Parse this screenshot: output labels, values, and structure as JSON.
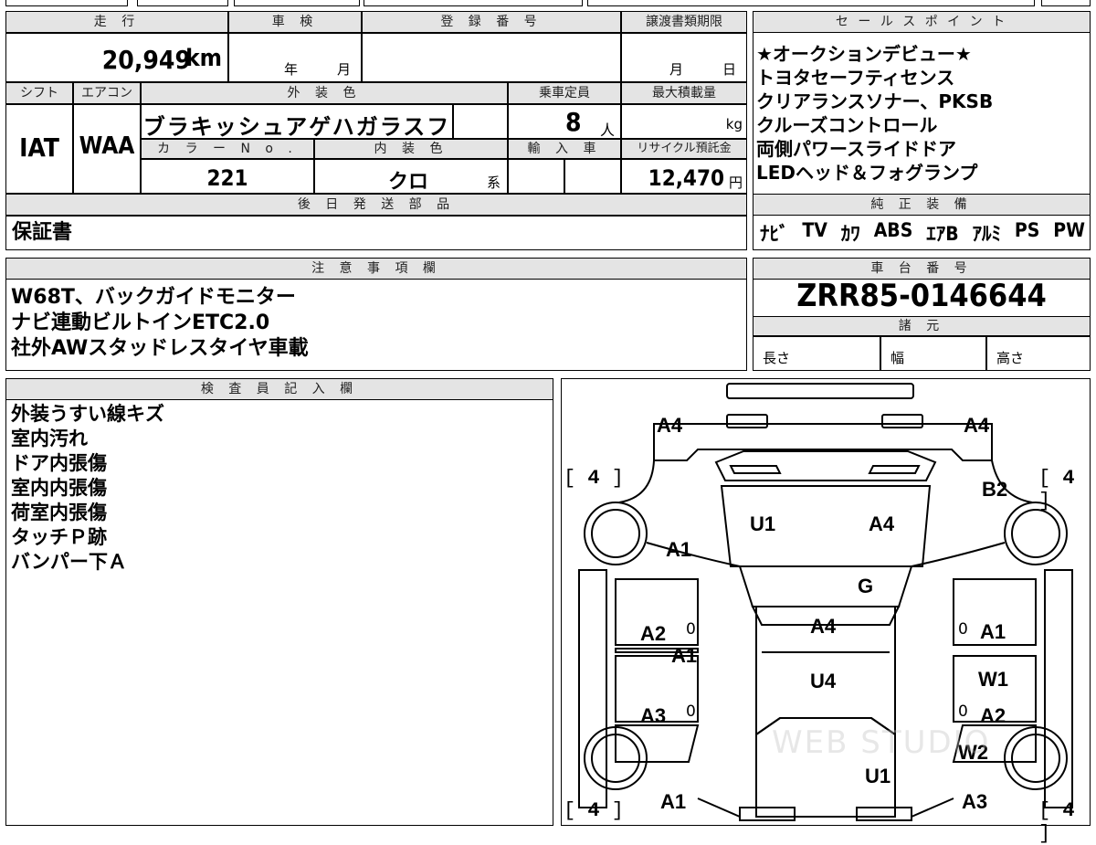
{
  "top_strip": [
    "",
    "",
    "",
    "",
    "",
    ""
  ],
  "mileage": {
    "header": "走 行",
    "value": "20,949",
    "unit": "km"
  },
  "shaken": {
    "header": "車 検",
    "year": "年",
    "month": "月"
  },
  "reg": {
    "header": "登 録 番 号",
    "value": ""
  },
  "transfer": {
    "header": "譲渡書類期限",
    "month": "月",
    "day": "日"
  },
  "shift": {
    "header": "シフト",
    "value": "IAT"
  },
  "aircon": {
    "header": "エアコン",
    "value": "WAA"
  },
  "ext_color": {
    "header": "外 装 色",
    "value": "ブラキッシュアゲハガラスフ"
  },
  "capacity": {
    "header": "乗車定員",
    "value": "8",
    "unit": "人"
  },
  "max_load": {
    "header": "最大積載量",
    "unit": "kg"
  },
  "color_no": {
    "header": "カ ラ ー N o .",
    "value": "221"
  },
  "int_color": {
    "header": "内 装 色",
    "value": "クロ",
    "suffix": "系"
  },
  "import": {
    "header": "輸 入 車"
  },
  "recycle": {
    "header": "リサイクル預託金",
    "value": "12,470",
    "unit": "円"
  },
  "later_parts": {
    "header": "後 日 発 送 部 品",
    "value": "保証書"
  },
  "sales": {
    "header": "セ ー ル ス ポ イ ン ト",
    "items": [
      "★オークションデビュー★",
      "トヨタセーフティセンス",
      "クリアランスソナー、PKSB",
      "クルーズコントロール",
      "両側パワースライドドア",
      "LEDヘッド＆フォグランプ"
    ]
  },
  "equipment": {
    "header": "純 正 装 備",
    "items": [
      "ﾅﾋﾞ",
      "TV",
      "ｶﾜ",
      "ABS",
      "ｴｱB",
      "ｱﾙﾐ",
      "PS",
      "PW"
    ]
  },
  "notes": {
    "header": "注 意 事 項 欄",
    "lines": [
      "W68T、バックガイドモニター",
      "ナビ連動ビルトインETC2.0",
      "社外AWスタッドレスタイヤ車載"
    ]
  },
  "chassis": {
    "header": "車 台 番 号",
    "value": "ZRR85-0146644"
  },
  "specs": {
    "header": "諸 元",
    "length": "長さ",
    "width": "幅",
    "height": "高さ"
  },
  "inspector": {
    "header": "検 査 員 記 入 欄",
    "lines": [
      "外装うすい線キズ",
      "室内汚れ",
      "ドア内張傷",
      "室内内張傷",
      "荷室内張傷",
      "タッチＰ跡",
      "バンパー下Ａ"
    ]
  },
  "diagram": {
    "labels": [
      "A4",
      "A4",
      "B2",
      "U1",
      "A4",
      "A1",
      "G",
      "A2",
      "A1",
      "A1",
      "A4",
      "U4",
      "W1",
      "A3",
      "A2",
      "W2",
      "U1",
      "A1",
      "A3"
    ],
    "tires": [
      "4",
      "4",
      "4",
      "4"
    ],
    "door_marks": [
      "0",
      "0",
      "0",
      "0"
    ],
    "watermark": "WEB STUDIO"
  }
}
